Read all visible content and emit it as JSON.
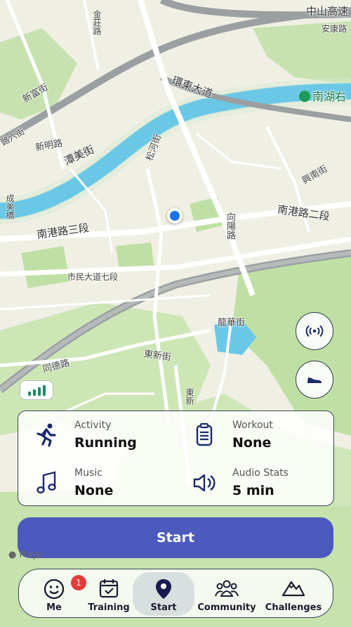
{
  "map": {
    "labels": {
      "zhongshan_hwy": "中山高速",
      "anle_rd": "安康路",
      "nanhu": "南湖右",
      "huandong": "環東大道",
      "jinzhuang": "金莊路",
      "xinfu": "新富街",
      "xinming": "新明路",
      "tanmei": "潭美街",
      "songhe": "松河街",
      "xingnan": "興南街",
      "chengmei": "成美橋",
      "nangang3": "南港路三段",
      "nangang2": "南港路二段",
      "xiangyang": "向陽路",
      "shimin": "市民大道七段",
      "longhua": "龍華街",
      "dongxin": "東新街",
      "tongde": "同德路",
      "dongxin2": "東新",
      "liuhe": "路六街"
    },
    "apple_maps": "Maps"
  },
  "signal_indicator": {
    "icon": "signal-bars-icon"
  },
  "map_buttons": [
    {
      "icon": "broadcast-icon"
    },
    {
      "icon": "shoe-icon"
    }
  ],
  "activity_card": {
    "activity": {
      "label": "Activity",
      "value": "Running",
      "icon": "runner-icon"
    },
    "workout": {
      "label": "Workout",
      "value": "None",
      "icon": "clipboard-icon"
    },
    "music": {
      "label": "Music",
      "value": "None",
      "icon": "music-note-icon"
    },
    "audio_stats": {
      "label": "Audio Stats",
      "value": "5 min",
      "icon": "speaker-icon"
    }
  },
  "start_button": {
    "label": "Start"
  },
  "nav": {
    "items": [
      {
        "label": "Me",
        "icon": "smiley-icon",
        "badge": "1"
      },
      {
        "label": "Training",
        "icon": "calendar-check-icon"
      },
      {
        "label": "Start",
        "icon": "location-pin-icon",
        "active": true
      },
      {
        "label": "Community",
        "icon": "people-icon"
      },
      {
        "label": "Challenges",
        "icon": "mountain-icon"
      }
    ]
  },
  "colors": {
    "accent": "#4d5abd",
    "location": "#1c74e8",
    "river": "#6ac8e6",
    "park": "#b9dd9c"
  }
}
